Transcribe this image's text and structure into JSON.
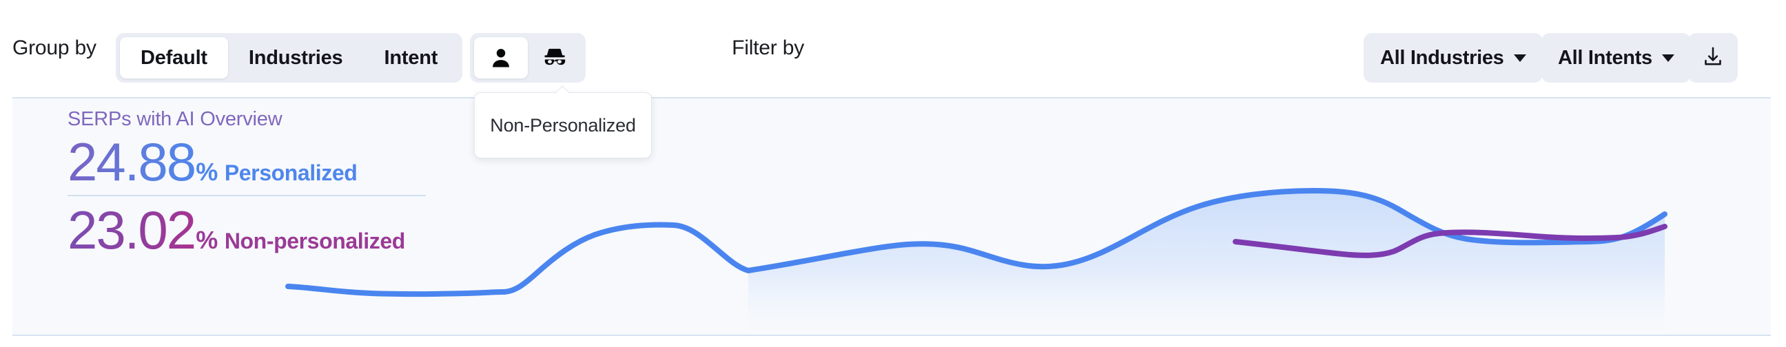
{
  "toolbar": {
    "group_by_label": "Group by",
    "group_options": [
      {
        "label": "Default",
        "active": true
      },
      {
        "label": "Industries",
        "active": false
      },
      {
        "label": "Intent",
        "active": false
      }
    ],
    "mode_buttons": [
      {
        "icon": "person-icon",
        "name": "Personalized",
        "active": true
      },
      {
        "icon": "incognito-icon",
        "name": "Non-Personalized",
        "active": false
      }
    ],
    "tooltip": {
      "text": "Non-Personalized"
    },
    "filter_by_label": "Filter by",
    "filters": [
      {
        "id": "industries",
        "label": "All Industries"
      },
      {
        "id": "intents",
        "label": "All Intents"
      }
    ],
    "download_label": "download-icon"
  },
  "panel": {
    "caption": "SERPs with AI Overview",
    "stats": [
      {
        "value": "24.88",
        "unit": "%",
        "name": "Personalized",
        "color": "#4f86ec"
      },
      {
        "value": "23.02",
        "unit": "%",
        "name": "Non-personalized",
        "color": "#9b3a96"
      }
    ]
  },
  "chart_data": {
    "type": "area",
    "title": "SERPs with AI Overview",
    "xlabel": "",
    "ylabel": "",
    "grid": false,
    "legend": "none",
    "ylim": [
      0,
      30
    ],
    "series": [
      {
        "name": "Personalized",
        "color": "#4f86ec",
        "fill": "#dce7fb",
        "x": [
          0,
          1,
          2,
          3,
          4,
          5,
          6,
          7,
          8,
          9,
          10,
          11,
          12,
          13,
          14,
          15,
          16,
          17,
          18,
          19,
          20
        ],
        "values": [
          21.2,
          20.9,
          20.8,
          20.8,
          20.8,
          20.8,
          21.0,
          23.4,
          24.6,
          24.5,
          24.0,
          23.8,
          24.4,
          26.2,
          27.0,
          27.0,
          26.1,
          25.3,
          25.1,
          25.0,
          26.4
        ]
      },
      {
        "name": "Non-personalized",
        "color": "#7d3bb0",
        "fill": "none",
        "x": [
          12,
          13,
          14,
          15,
          16,
          17,
          18,
          19,
          20
        ],
        "values": [
          23.9,
          23.4,
          23.2,
          24.3,
          24.4,
          24.2,
          24.0,
          24.0,
          24.6
        ]
      }
    ]
  }
}
